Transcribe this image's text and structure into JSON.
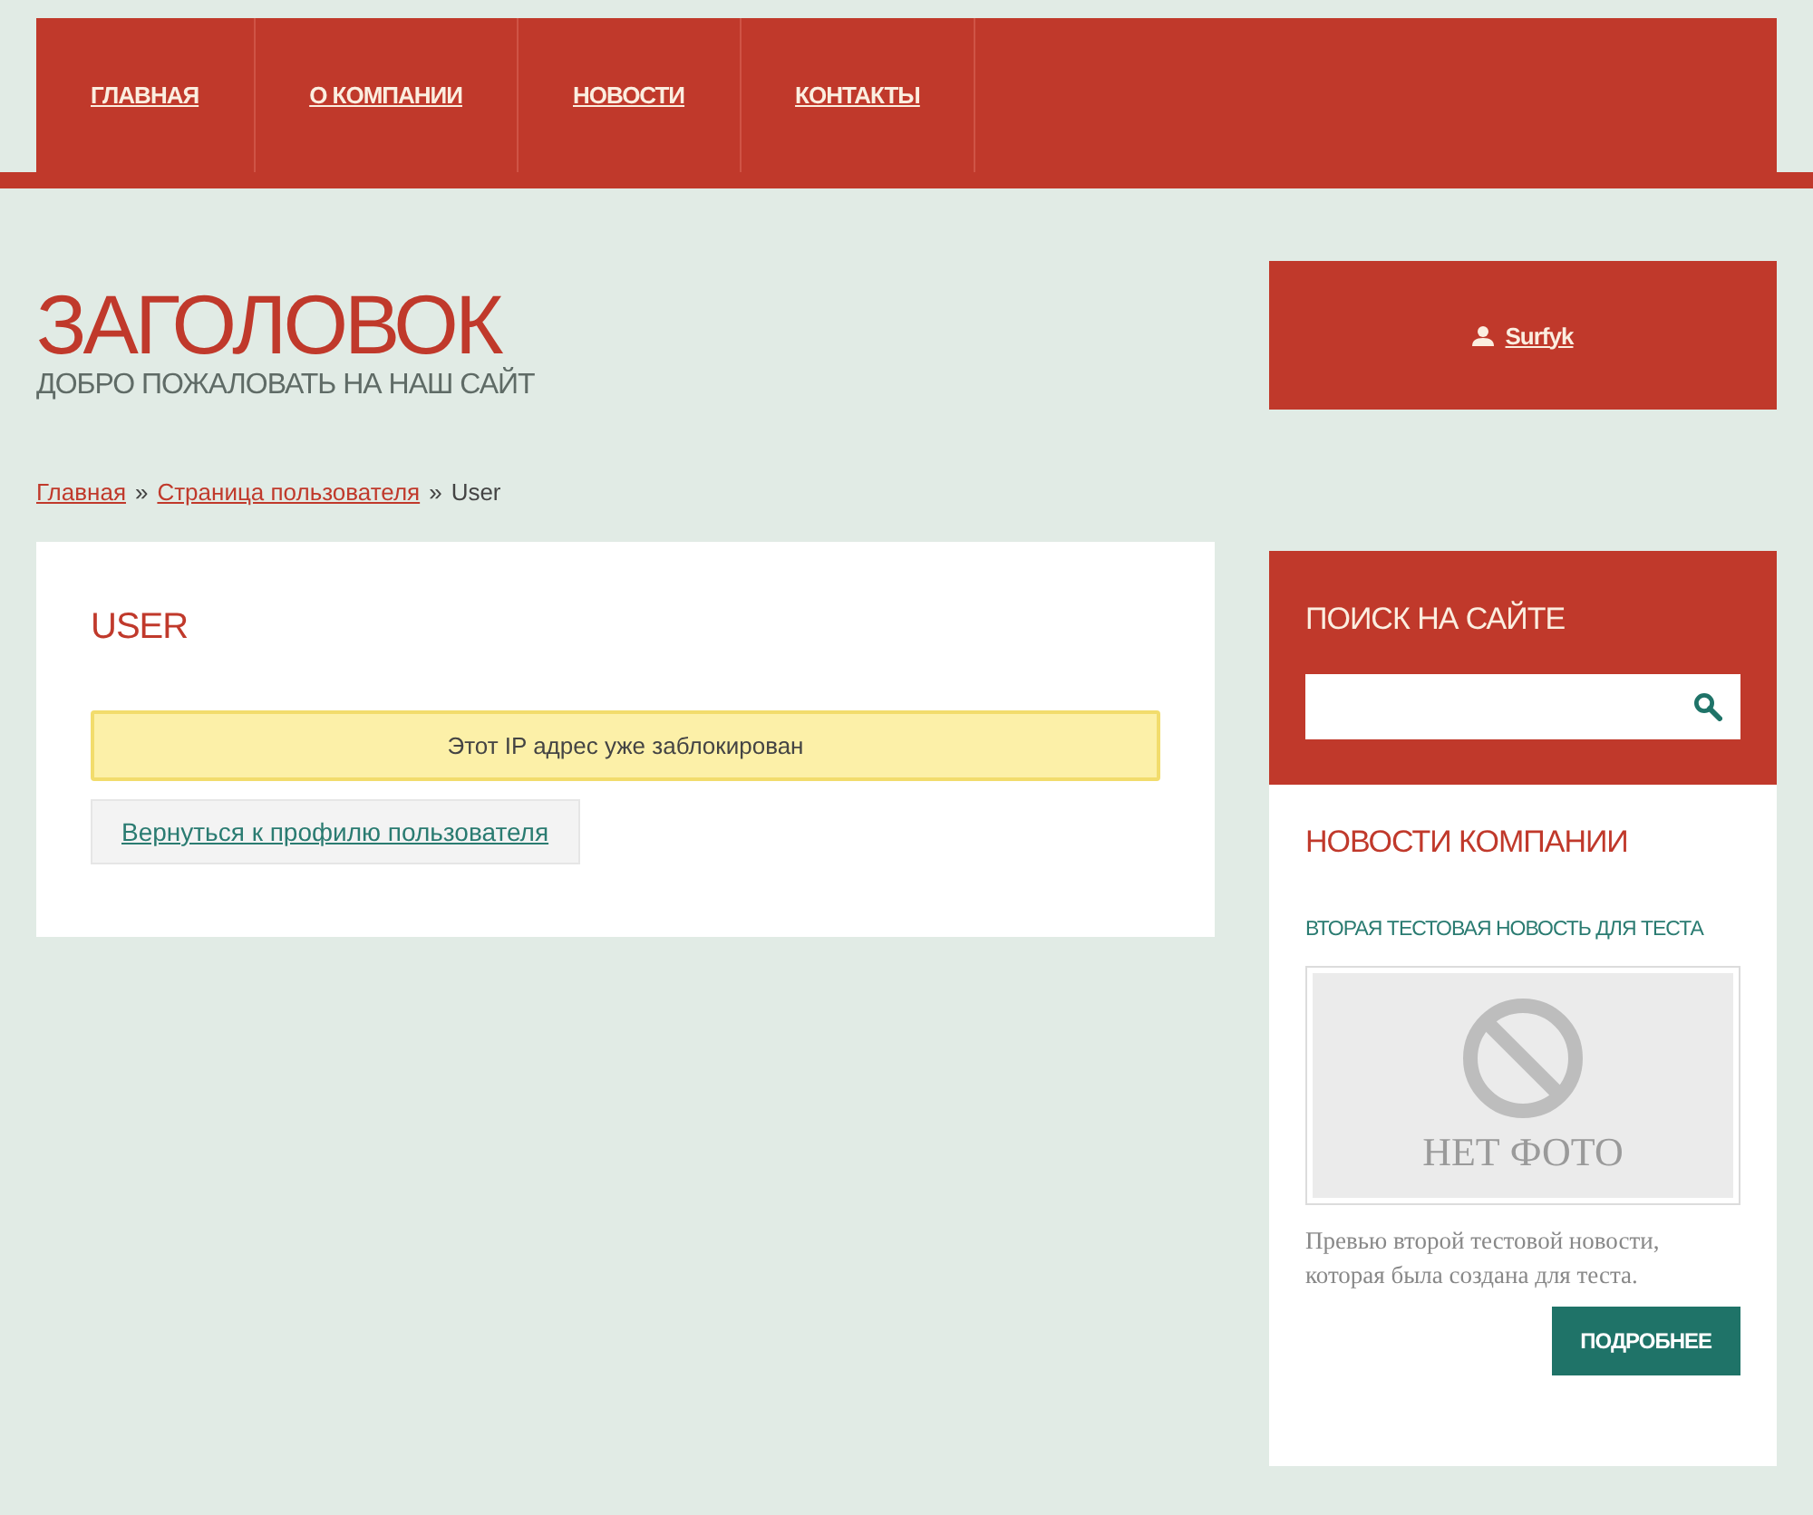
{
  "nav": {
    "items": [
      {
        "label": "ГЛАВНАЯ"
      },
      {
        "label": "О КОМПАНИИ"
      },
      {
        "label": "НОВОСТИ"
      },
      {
        "label": "КОНТАКТЫ"
      }
    ]
  },
  "header": {
    "title": "ЗАГОЛОВОК",
    "subtitle": "ДОБРО ПОЖАЛОВАТЬ НА НАШ САЙТ"
  },
  "user_box": {
    "username": "Surfyk"
  },
  "breadcrumbs": {
    "links": [
      "Главная",
      "Страница пользователя"
    ],
    "separator": "»",
    "current": "User"
  },
  "content": {
    "title": "USER",
    "alert": "Этот IP адрес уже заблокирован",
    "back_link": "Вернуться к профилю пользователя"
  },
  "search": {
    "title": "ПОИСК НА САЙТЕ"
  },
  "news": {
    "title": "НОВОСТИ КОМПАНИИ",
    "item": {
      "title": "ВТОРАЯ ТЕСТОВАЯ НОВОСТЬ ДЛЯ ТЕСТА",
      "image_text": "НЕТ ФОТО",
      "preview": "Превью второй тестовой новости, которая была создана для теста.",
      "button": "ПОДРОБНЕЕ"
    }
  }
}
